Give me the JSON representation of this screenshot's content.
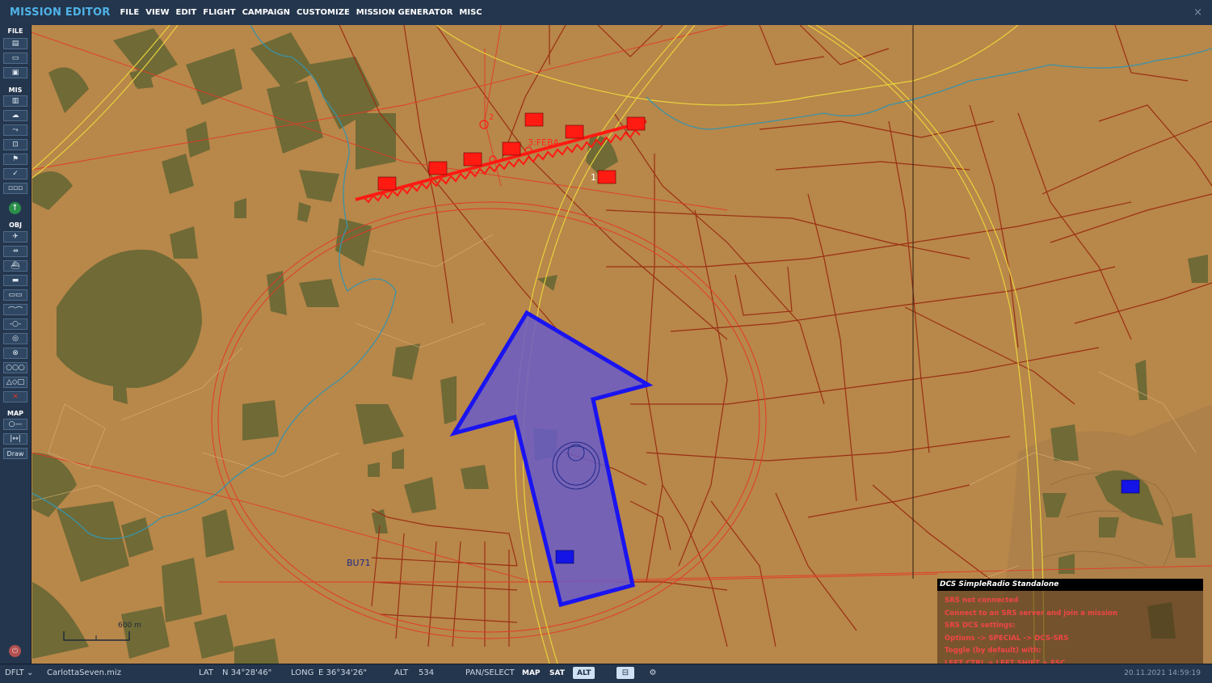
{
  "app": {
    "title": "MISSION EDITOR",
    "menu": [
      "FILE",
      "VIEW",
      "EDIT",
      "FLIGHT",
      "CAMPAIGN",
      "CUSTOMIZE",
      "MISSION GENERATOR",
      "MISC"
    ],
    "close_icon": "close-icon"
  },
  "sidebar": {
    "sections": {
      "file": "FILE",
      "mis": "MIS",
      "obj": "OBJ",
      "map": "MAP"
    },
    "file_buttons": [
      "new-file-icon",
      "open-folder-icon",
      "save-icon"
    ],
    "mis_buttons": [
      "briefing-icon",
      "weather-icon",
      "triggers-icon",
      "goals-icon",
      "flag-icon",
      "check-icon",
      "waypoints-icon"
    ],
    "obj_buttons": [
      "plane-icon",
      "helicopter-icon",
      "ship-icon",
      "vehicle-icon",
      "static-object-icon",
      "bridge-icon",
      "waypoint-icon",
      "target-icon",
      "zone-icon",
      "templates-icon",
      "shapes-icon",
      "delete-icon"
    ],
    "map_buttons": [
      "measure-icon",
      "ruler-icon"
    ],
    "draw_label": "Draw",
    "x_label": "✕"
  },
  "map": {
    "grid_label": "BU71",
    "frontline_label": "3:FEBA",
    "unit_label_1": "1",
    "unit_label_2": "2",
    "scale_label": "600 m",
    "colors": {
      "terrain": "#b8874a",
      "forest": "#6f6a36",
      "road": "#9a2f12",
      "highway": "#e8d23c",
      "river": "#3a93a8",
      "red_unit": "#ff1a12",
      "blue_unit": "#1414e6",
      "arrow_fill": "#6a5cc8"
    }
  },
  "status": {
    "mode": "DFLT",
    "filename": "CarlottaSeven.miz",
    "lat_label": "LAT",
    "lat_value": "N 34°28'46\"",
    "long_label": "LONG",
    "long_value": "E 36°34'26\"",
    "alt_label": "ALT",
    "alt_value": "534",
    "pan_label": "PAN/SELECT",
    "map_btn": "MAP",
    "sat_btn": "SAT",
    "alt_btn": "ALT",
    "datetime": "20.11.2021 14:59:19"
  },
  "srs": {
    "title": "DCS SimpleRadio Standalone",
    "lines": [
      "SRS not connected",
      "Connect to an SRS server and join a mission",
      "SRS DCS settings:",
      "Options -> SPECIAL -> DCS-SRS",
      "Toggle (by default) with:",
      "LEFT CTRL + LEFT SHIFT + ESC"
    ]
  }
}
